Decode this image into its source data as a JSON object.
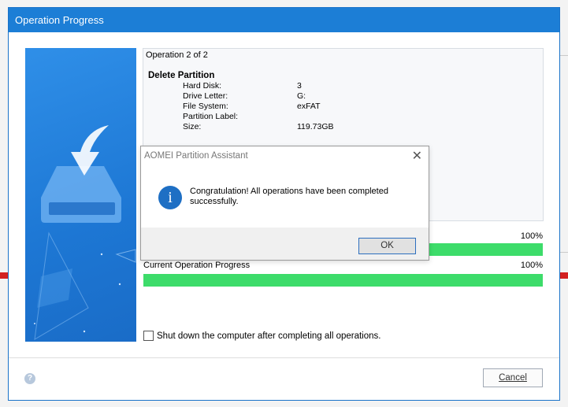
{
  "window": {
    "title": "Operation Progress"
  },
  "operation": {
    "counter": "Operation 2 of 2",
    "heading": "Delete Partition",
    "details": [
      {
        "key": "Hard Disk:",
        "value": "3"
      },
      {
        "key": "Drive Letter:",
        "value": "G:"
      },
      {
        "key": "File System:",
        "value": "exFAT"
      },
      {
        "key": "Partition Label:",
        "value": ""
      },
      {
        "key": "Size:",
        "value": "119.73GB"
      }
    ]
  },
  "progress": {
    "overall_label": "",
    "overall_pct_text": "100%",
    "overall_value": 1.0,
    "current_label": "Current Operation Progress",
    "current_pct_text": "100%",
    "current_value": 1.0
  },
  "shutdown": {
    "label": "Shut down the computer after completing all operations.",
    "checked": false
  },
  "footer": {
    "help_glyph": "?",
    "cancel_label": "Cancel"
  },
  "dialog": {
    "title": "AOMEI Partition Assistant",
    "close_glyph": "✕",
    "icon_glyph": "i",
    "message": "Congratulation! All operations have been completed successfully.",
    "ok_label": "OK"
  },
  "colors": {
    "titlebar": "#1c7ed6",
    "progress_fill": "#3ddc6a",
    "side_panel": "#1d77d4"
  }
}
